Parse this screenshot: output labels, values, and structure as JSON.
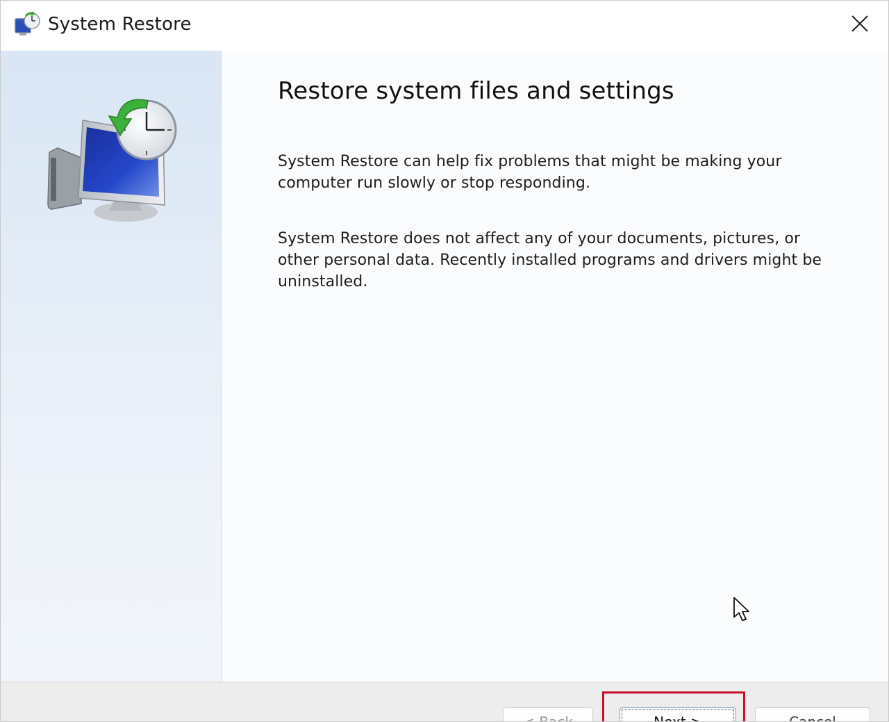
{
  "window": {
    "title": "System Restore",
    "icons": {
      "app": "system-restore-icon",
      "close": "close-icon"
    }
  },
  "side_panel": {
    "illustration": "system-restore-clock-monitor-icon"
  },
  "content": {
    "heading": "Restore system files and settings",
    "paragraphs": [
      "System Restore can help fix problems that might be making your computer run slowly or stop responding.",
      "System Restore does not affect any of your documents, pictures, or other personal data. Recently installed programs and drivers might be uninstalled."
    ]
  },
  "footer": {
    "buttons": {
      "back": "< Back",
      "next": "Next >",
      "cancel": "Cancel"
    },
    "highlighted": "next"
  },
  "colors": {
    "accent_highlight": "#c8102e",
    "side_panel_top": "#d9e6f4",
    "footer_bg": "#ededed"
  }
}
